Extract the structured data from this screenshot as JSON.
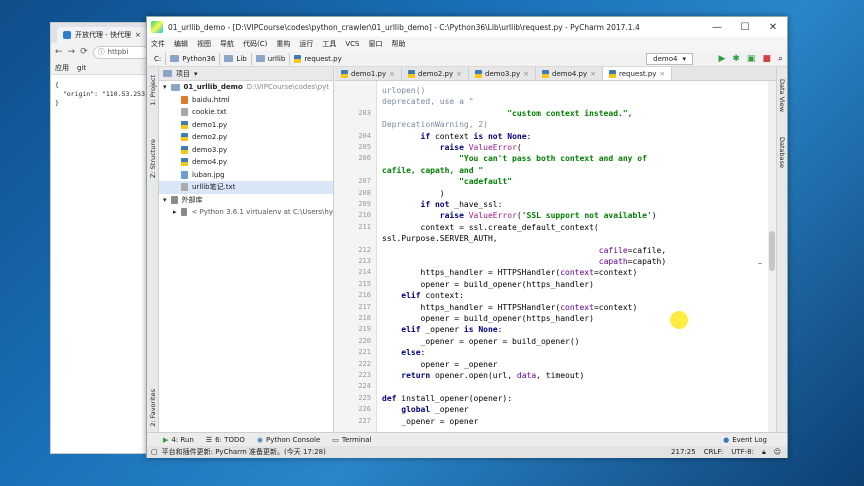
{
  "browser": {
    "tab_title": "开放代理 - 快代理",
    "url": "httpbi",
    "bookmarks": [
      "应用",
      "git"
    ],
    "content_lines": [
      "{",
      "  \"origin\": \"110.53.253.",
      "}"
    ]
  },
  "ide": {
    "title": "01_urllib_demo - [D:\\VIPCourse\\codes\\python_crawler\\01_urllib_demo] - C:\\Python36\\Lib\\urllib\\request.py - PyCharm 2017.1.4",
    "menu": [
      "文件",
      "编辑",
      "视图",
      "导航",
      "代码(C)",
      "重构",
      "运行",
      "工具",
      "VCS",
      "窗口",
      "帮助"
    ],
    "breadcrumbs": [
      "C:",
      "Python36",
      "Lib",
      "urllib",
      "request.py"
    ],
    "run_config": "demo4",
    "left_stripe": [
      "1: Project",
      "Z: Structure",
      "2: Favorites"
    ],
    "right_stripe": [
      "Data View",
      "Database"
    ],
    "project": {
      "header": "项目",
      "root": "01_urllib_demo",
      "root_path": "D:\\VIPCourse\\codes\\pyt",
      "files": [
        "baidu.html",
        "cookie.txt",
        "demo1.py",
        "demo2.py",
        "demo3.py",
        "demo4.py",
        "luban.jpg",
        "urllib笔记.txt"
      ],
      "external": "外部库",
      "external_item": "< Python 3.6.1 virtualenv at C:\\Users\\hy"
    },
    "tabs": [
      "demo1.py",
      "demo2.py",
      "demo3.py",
      "demo4.py",
      "request.py"
    ],
    "code_lines": [
      {
        "n": "",
        "segs": [
          [
            "muted",
            "urlopen()"
          ]
        ]
      },
      {
        "n": "",
        "segs": [
          [
            "muted",
            "deprecated, use a \""
          ]
        ]
      },
      {
        "n": "203",
        "segs": [
          [
            "str",
            "                          \"custom context instead.\","
          ]
        ]
      },
      {
        "n": "",
        "segs": [
          [
            "muted",
            "DeprecationWarning, 2)"
          ]
        ]
      },
      {
        "n": "204",
        "segs": [
          [
            "",
            "        "
          ],
          [
            "kw",
            "if"
          ],
          [
            "",
            " context "
          ],
          [
            "kw",
            "is not None"
          ],
          [
            "",
            ":"
          ]
        ]
      },
      {
        "n": "205",
        "segs": [
          [
            "",
            "            "
          ],
          [
            "kw",
            "raise"
          ],
          [
            "",
            " "
          ],
          [
            "cls",
            "ValueError"
          ],
          [
            "",
            "("
          ]
        ]
      },
      {
        "n": "206",
        "segs": [
          [
            "str",
            "                \"You can't pass both context and any of"
          ]
        ]
      },
      {
        "n": "",
        "segs": [
          [
            "str",
            "cafile, capath, and \""
          ]
        ]
      },
      {
        "n": "207",
        "segs": [
          [
            "str",
            "                \"cadefault\""
          ]
        ]
      },
      {
        "n": "208",
        "segs": [
          [
            "",
            "            )"
          ]
        ]
      },
      {
        "n": "209",
        "segs": [
          [
            "",
            "        "
          ],
          [
            "kw",
            "if not"
          ],
          [
            "",
            " _have_ssl:"
          ]
        ]
      },
      {
        "n": "210",
        "segs": [
          [
            "",
            "            "
          ],
          [
            "kw",
            "raise"
          ],
          [
            "",
            " "
          ],
          [
            "cls",
            "ValueError"
          ],
          [
            "",
            "("
          ],
          [
            "str",
            "'SSL support not available'"
          ],
          [
            "",
            ")"
          ]
        ]
      },
      {
        "n": "211",
        "segs": [
          [
            "",
            "        context = ssl.create_default_context("
          ]
        ]
      },
      {
        "n": "",
        "segs": [
          [
            "",
            "ssl.Purpose.SERVER_AUTH,"
          ]
        ]
      },
      {
        "n": "212",
        "segs": [
          [
            "",
            "                                             "
          ],
          [
            "param",
            "cafile"
          ],
          [
            "",
            "=cafile,"
          ]
        ]
      },
      {
        "n": "213",
        "segs": [
          [
            "",
            "                                             "
          ],
          [
            "param",
            "capath"
          ],
          [
            "",
            "=capath)"
          ]
        ]
      },
      {
        "n": "214",
        "segs": [
          [
            "",
            "        https_handler = HTTPSHandler("
          ],
          [
            "param",
            "context"
          ],
          [
            "",
            "=context)"
          ]
        ]
      },
      {
        "n": "215",
        "segs": [
          [
            "",
            "        opener = build_opener(https_handler)"
          ]
        ]
      },
      {
        "n": "216",
        "segs": [
          [
            "",
            "    "
          ],
          [
            "kw",
            "elif"
          ],
          [
            "",
            " context:"
          ]
        ]
      },
      {
        "n": "217",
        "segs": [
          [
            "",
            "        https_handler = HTTPSHandler("
          ],
          [
            "param",
            "context"
          ],
          [
            "",
            "=context)"
          ]
        ]
      },
      {
        "n": "218",
        "segs": [
          [
            "",
            "        opener = build_opener(https_handler)"
          ]
        ]
      },
      {
        "n": "219",
        "segs": [
          [
            "",
            "    "
          ],
          [
            "kw",
            "elif"
          ],
          [
            "",
            " _opener "
          ],
          [
            "kw",
            "is None"
          ],
          [
            "",
            ":"
          ]
        ]
      },
      {
        "n": "220",
        "segs": [
          [
            "",
            "        _opener = opener = build_opener()"
          ]
        ]
      },
      {
        "n": "221",
        "segs": [
          [
            "",
            "    "
          ],
          [
            "kw",
            "else"
          ],
          [
            "",
            ":"
          ]
        ]
      },
      {
        "n": "222",
        "segs": [
          [
            "",
            "        opener = _opener"
          ]
        ]
      },
      {
        "n": "223",
        "segs": [
          [
            "",
            "    "
          ],
          [
            "kw",
            "return"
          ],
          [
            "",
            " opener.open(url, "
          ],
          [
            "param",
            "data"
          ],
          [
            "",
            ", timeout)"
          ]
        ]
      },
      {
        "n": "224",
        "segs": [
          [
            "",
            ""
          ]
        ]
      },
      {
        "n": "225",
        "segs": [
          [
            "kw",
            "def"
          ],
          [
            "",
            " install_opener(opener):"
          ]
        ]
      },
      {
        "n": "226",
        "segs": [
          [
            "",
            "    "
          ],
          [
            "kw",
            "global"
          ],
          [
            "",
            " _opener"
          ]
        ]
      },
      {
        "n": "227",
        "segs": [
          [
            "",
            "    _opener = opener"
          ]
        ]
      }
    ],
    "toolwindows": [
      "4: Run",
      "6: TODO",
      "Python Console",
      "Terminal"
    ],
    "event_log": "Event Log",
    "status_msg": "平台和插件更新: PyCharm 准备更新。(今天 17:28)",
    "status_pos": "217:25",
    "status_crlf": "CRLF:",
    "status_enc": "UTF-8:"
  }
}
